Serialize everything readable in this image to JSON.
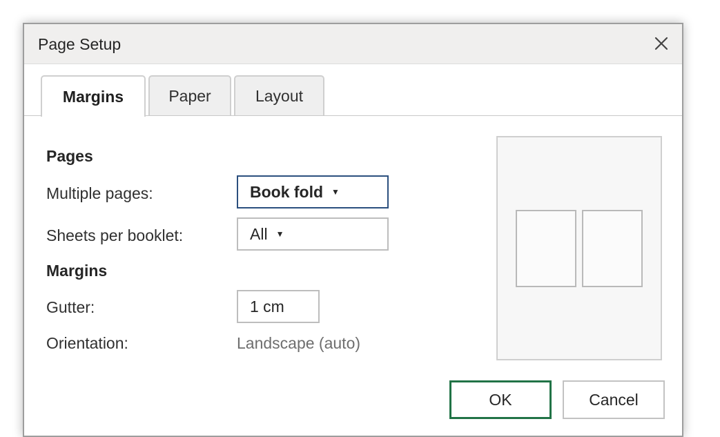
{
  "dialog": {
    "title": "Page Setup",
    "close_icon": "close-icon"
  },
  "tabs": [
    {
      "label": "Margins",
      "active": true
    },
    {
      "label": "Paper",
      "active": false
    },
    {
      "label": "Layout",
      "active": false
    }
  ],
  "pages_section": {
    "heading": "Pages",
    "multiple_pages": {
      "label": "Multiple pages:",
      "value": "Book fold",
      "arrow_icon": "dropdown-arrow-icon"
    },
    "sheets_per_booklet": {
      "label": "Sheets per booklet:",
      "value": "All",
      "arrow_icon": "dropdown-arrow-icon"
    }
  },
  "margins_section": {
    "heading": "Margins",
    "gutter": {
      "label": "Gutter:",
      "value": "1 cm"
    },
    "orientation": {
      "label": "Orientation:",
      "value": "Landscape (auto)"
    }
  },
  "buttons": {
    "ok": "OK",
    "cancel": "Cancel"
  },
  "colors": {
    "focus_border": "#2b4f7e",
    "primary_button_border": "#217346",
    "titlebar_bg": "#f0efee"
  }
}
